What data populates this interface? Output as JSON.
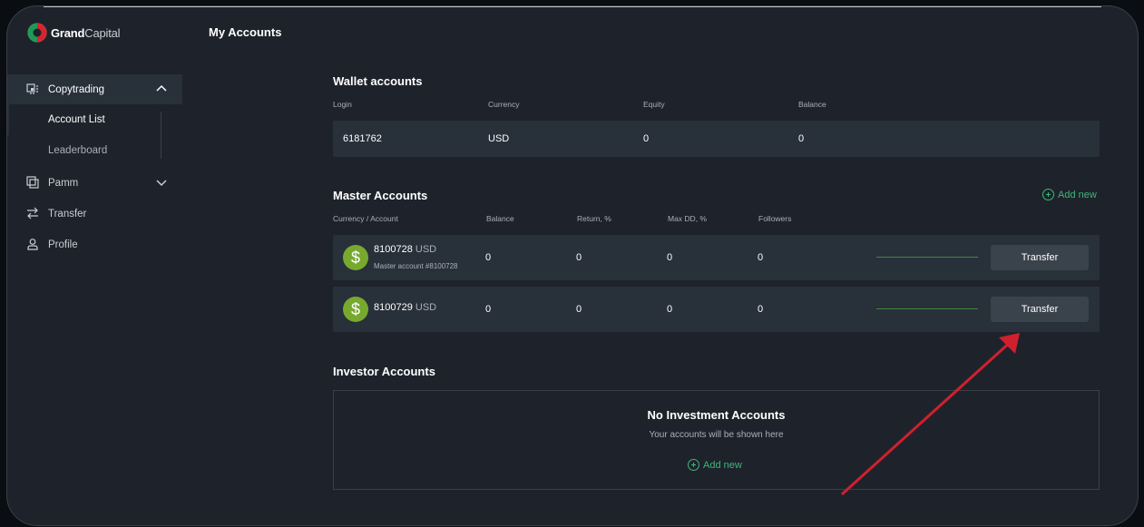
{
  "brand": {
    "name_bold": "Grand",
    "name_light": "Capital"
  },
  "page_title": "My Accounts",
  "sidebar": {
    "copytrading": "Copytrading",
    "account_list": "Account List",
    "leaderboard": "Leaderboard",
    "pamm": "Pamm",
    "transfer": "Transfer",
    "profile": "Profile"
  },
  "wallet": {
    "title": "Wallet accounts",
    "headers": [
      "Login",
      "Currency",
      "Equity",
      "Balance"
    ],
    "row": {
      "login": "6181762",
      "currency": "USD",
      "equity": "0",
      "balance": "0"
    }
  },
  "master": {
    "title": "Master Accounts",
    "add_new": "Add new",
    "headers": [
      "Currency / Account",
      "Balance",
      "Return, %",
      "Max DD, %",
      "Followers"
    ],
    "rows": [
      {
        "number": "8100728",
        "currency": "USD",
        "subtitle": "Master account #8100728",
        "balance": "0",
        "return": "0",
        "maxdd": "0",
        "followers": "0",
        "button": "Transfer"
      },
      {
        "number": "8100729",
        "currency": "USD",
        "subtitle": "",
        "balance": "0",
        "return": "0",
        "maxdd": "0",
        "followers": "0",
        "button": "Transfer"
      }
    ]
  },
  "investor": {
    "title": "Investor Accounts",
    "empty_title": "No Investment Accounts",
    "empty_sub": "Your accounts will be shown here",
    "add_new": "Add new"
  },
  "colors": {
    "accent": "#3db67a",
    "coin": "#78a92f",
    "annotation_arrow": "#d0202e"
  }
}
